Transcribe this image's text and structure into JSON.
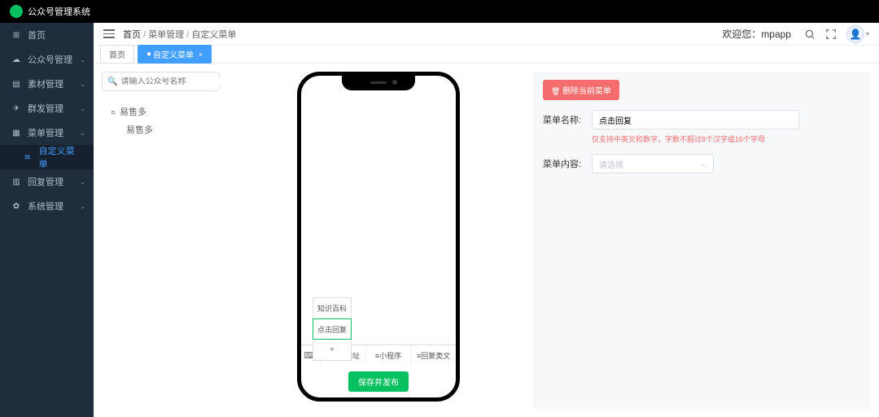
{
  "brand": {
    "name": "公众号管理系统"
  },
  "sidebar": {
    "items": [
      {
        "icon": "⊞",
        "label": "首页",
        "chev": ""
      },
      {
        "icon": "☁",
        "label": "公众号管理",
        "chev": "⌄"
      },
      {
        "icon": "▤",
        "label": "素材管理",
        "chev": "⌄"
      },
      {
        "icon": "✈",
        "label": "群发管理",
        "chev": "⌄"
      },
      {
        "icon": "▦",
        "label": "菜单管理",
        "chev": "⌄"
      },
      {
        "icon": "≋",
        "label": "自定义菜单",
        "chev": "",
        "sub": true,
        "active": true
      },
      {
        "icon": "▥",
        "label": "回复管理",
        "chev": "⌄"
      },
      {
        "icon": "✿",
        "label": "系统管理",
        "chev": "⌄"
      }
    ]
  },
  "header": {
    "breadcrumb": [
      "首页",
      "菜单管理",
      "自定义菜单"
    ],
    "bc_sep": " / ",
    "welcome_prefix": "欢迎您：",
    "welcome_user": "mpapp"
  },
  "tabs": [
    {
      "label": "首页",
      "active": false
    },
    {
      "label": "自定义菜单",
      "active": true,
      "closable": true
    }
  ],
  "tree": {
    "search_placeholder": "请输入公众号名称",
    "root": "易售多",
    "child": "易售多"
  },
  "phone": {
    "submenu": [
      {
        "label": "知识百科"
      },
      {
        "label": "点击回复",
        "selected": true
      },
      {
        "label": "+"
      }
    ],
    "bottom_menus": [
      "≡百度地址",
      "≡小程序",
      "≡回复类文"
    ],
    "publish": "保存并发布"
  },
  "form": {
    "delete_btn": "删除当前菜单",
    "name_label": "菜单名称:",
    "name_value": "点击回复",
    "name_hint": "仅支持中英文和数字，字数不超过8个汉字或16个字母",
    "content_label": "菜单内容:",
    "content_placeholder": "请选择"
  }
}
